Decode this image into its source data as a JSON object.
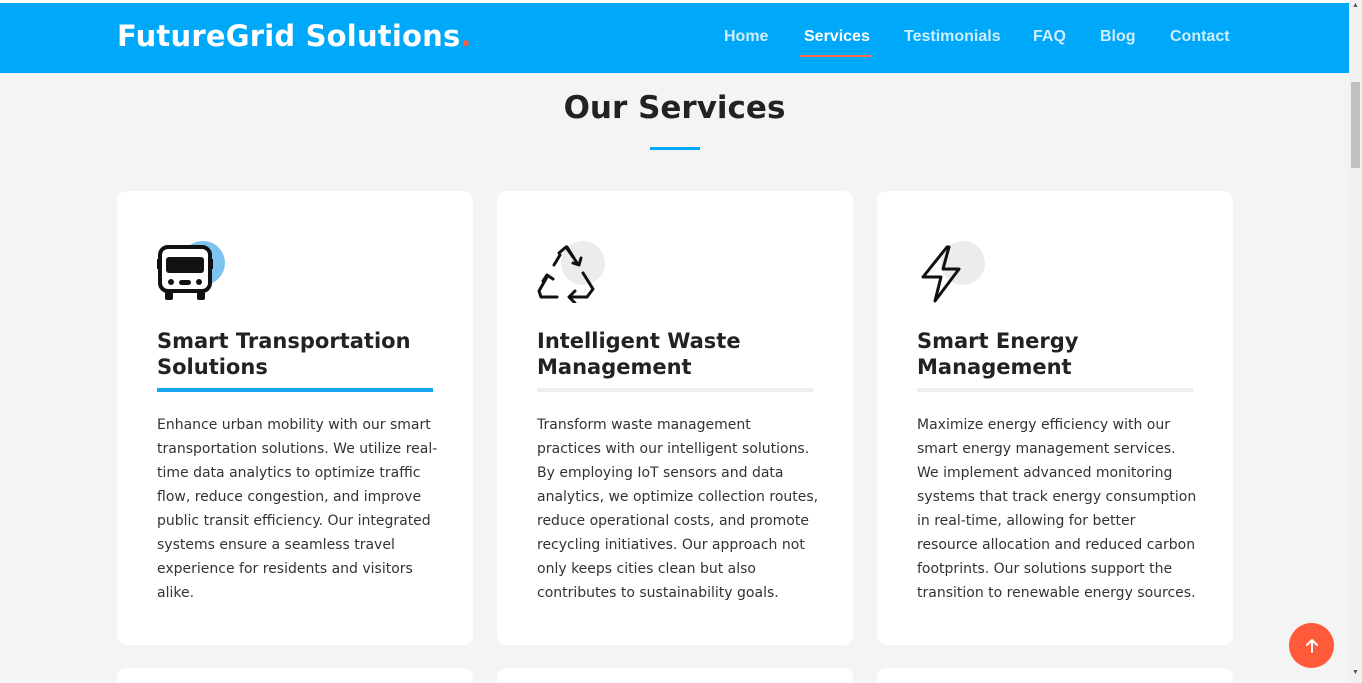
{
  "brand": {
    "name": "FutureGrid Solutions",
    "dot": ".",
    "accent": "#ff5b3a",
    "primary": "#00a8f9"
  },
  "nav": {
    "items": [
      {
        "label": "Home"
      },
      {
        "label": "Services",
        "active": true
      },
      {
        "label": "Testimonials"
      },
      {
        "label": "FAQ"
      },
      {
        "label": "Blog"
      },
      {
        "label": "Contact"
      }
    ]
  },
  "services": {
    "title": "Our Services",
    "cards": [
      {
        "icon": "bus-icon",
        "title": "Smart Transportation Solutions",
        "text": "Enhance urban mobility with our smart transportation solutions. We utilize real-time data analytics to optimize traffic flow, reduce congestion, and improve public transit efficiency. Our integrated systems ensure a seamless travel experience for residents and visitors alike."
      },
      {
        "icon": "recycle-icon",
        "title": "Intelligent Waste Management",
        "text": "Transform waste management practices with our intelligent solutions. By employing IoT sensors and data analytics, we optimize collection routes, reduce operational costs, and promote recycling initiatives. Our approach not only keeps cities clean but also contributes to sustainability goals."
      },
      {
        "icon": "lightning-bolt-icon",
        "title": "Smart Energy Management",
        "text": "Maximize energy efficiency with our smart energy management services. We implement advanced monitoring systems that track energy consumption in real-time, allowing for better resource allocation and reduced carbon footprints. Our solutions support the transition to renewable energy sources."
      }
    ]
  },
  "back_to_top": {
    "icon": "arrow-up-icon"
  }
}
